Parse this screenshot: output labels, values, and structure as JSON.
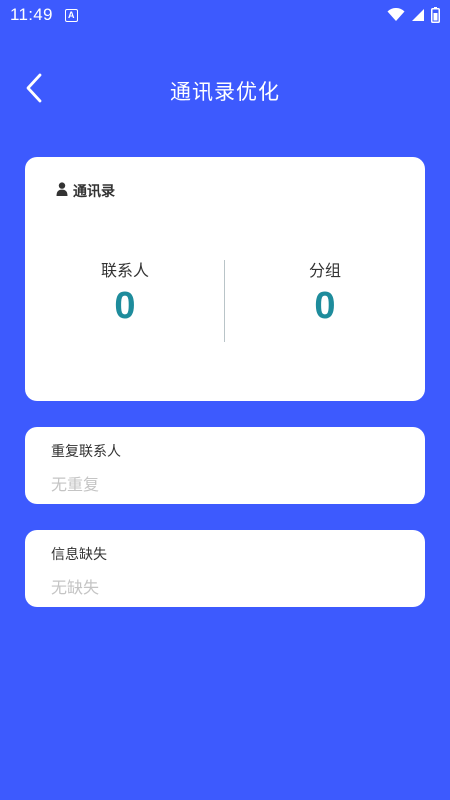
{
  "status_bar": {
    "time": "11:49",
    "notification_icon": "a-icon",
    "icons": [
      "wifi-icon",
      "signal-icon",
      "battery-icon"
    ]
  },
  "header": {
    "back_icon": "chevron-left-icon",
    "title": "通讯录优化"
  },
  "contacts_card": {
    "icon": "person-icon",
    "heading": "通讯录",
    "stats": [
      {
        "label": "联系人",
        "value": "0"
      },
      {
        "label": "分组",
        "value": "0"
      }
    ]
  },
  "duplicates_card": {
    "title": "重复联系人",
    "value": "无重复"
  },
  "missing_card": {
    "title": "信息缺失",
    "value": "无缺失"
  },
  "colors": {
    "background": "#3d5afe",
    "card": "#ffffff",
    "stat_value": "#1e8c9c",
    "muted_text": "#c4c4c4"
  }
}
